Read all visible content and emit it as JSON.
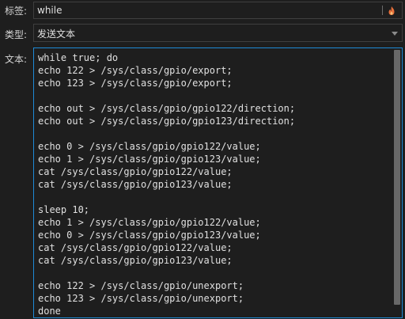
{
  "fields": {
    "tag_label": "标签:",
    "tag_value": "while",
    "type_label": "类型:",
    "type_value": "发送文本",
    "text_label": "文本:",
    "text_value": "while true; do\necho 122 > /sys/class/gpio/export;\necho 123 > /sys/class/gpio/export;\n\necho out > /sys/class/gpio/gpio122/direction;\necho out > /sys/class/gpio/gpio123/direction;\n\necho 0 > /sys/class/gpio/gpio122/value;\necho 1 > /sys/class/gpio/gpio123/value;\ncat /sys/class/gpio/gpio122/value;\ncat /sys/class/gpio/gpio123/value;\n\nsleep 10;\necho 1 > /sys/class/gpio/gpio122/value;\necho 0 > /sys/class/gpio/gpio123/value;\ncat /sys/class/gpio/gpio122/value;\ncat /sys/class/gpio/gpio123/value;\n\necho 122 > /sys/class/gpio/unexport;\necho 123 > /sys/class/gpio/unexport;\ndone"
  },
  "icons": {
    "tag_action": "flame-icon",
    "type_dropdown": "chevron-down-icon"
  },
  "colors": {
    "background": "#1e1e1e",
    "focus_border": "#1e8ad6",
    "icon_accent": "#e8703a"
  }
}
